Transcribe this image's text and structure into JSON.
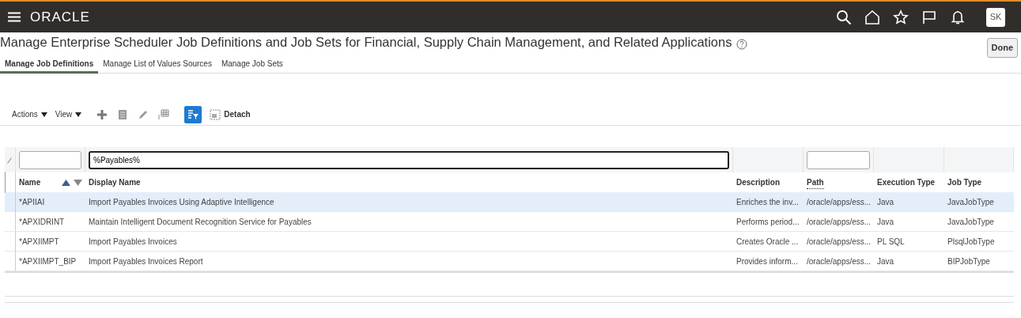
{
  "header": {
    "logo": "ORACLE",
    "user_initials": "SK"
  },
  "page": {
    "title": "Manage Enterprise Scheduler Job Definitions and Job Sets for Financial, Supply Chain Management, and Related Applications",
    "done_button": "Done"
  },
  "tabs": [
    {
      "label": "Manage Job Definitions",
      "selected": true
    },
    {
      "label": "Manage List of Values Sources",
      "selected": false
    },
    {
      "label": "Manage Job Sets",
      "selected": false
    }
  ],
  "toolbar": {
    "menus": [
      "Actions",
      "View"
    ],
    "query_by_example": {
      "on": true
    },
    "detach": "Detach"
  },
  "table": {
    "columns": [
      {
        "label": "Name",
        "kind": "filterable"
      },
      {
        "label": "Display Name",
        "kind": "filterable",
        "filter_value": "%Payables%"
      },
      {
        "label": "Description",
        "kind": "plain"
      },
      {
        "label": "Path",
        "kind": "filterable"
      },
      {
        "label": "Execution Type",
        "kind": "plain"
      },
      {
        "label": "Job Type",
        "kind": "plain"
      }
    ],
    "rows": [
      {
        "selected": true,
        "cells": [
          "*APIIAI",
          "Import Payables Invoices Using Adaptive Intelligence",
          "Enriches the inv...",
          "/oracle/apps/ess...",
          "Java",
          "JavaJobType"
        ]
      },
      {
        "selected": false,
        "cells": [
          "*APXIDRINT",
          "Maintain Intelligent Document Recognition Service for Payables",
          "Performs period...",
          "/oracle/apps/ess...",
          "Java",
          "JavaJobType"
        ]
      },
      {
        "selected": false,
        "cells": [
          "*APXIIMPT",
          "Import Payables Invoices",
          "Creates Oracle ...",
          "/oracle/apps/ess...",
          "PL SQL",
          "PlsqlJobType"
        ]
      },
      {
        "selected": false,
        "cells": [
          "*APXIIMPT_BIP",
          "Import Payables Invoices Report",
          "Provides inform...",
          "/oracle/apps/ess...",
          "Java",
          "BIPJobType"
        ]
      }
    ]
  }
}
